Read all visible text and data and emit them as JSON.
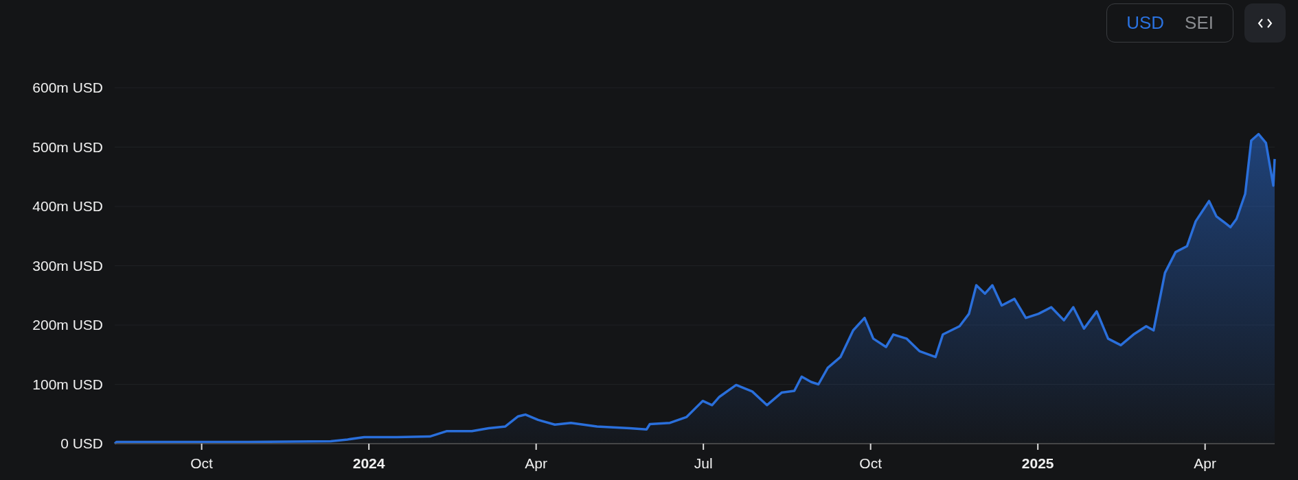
{
  "currency_toggle": {
    "options": [
      {
        "label": "USD",
        "selected": true
      },
      {
        "label": "SEI",
        "selected": false
      }
    ]
  },
  "chart": {
    "chart_data": {
      "type": "area",
      "grid": true,
      "xlim": [
        2023.62,
        2025.354
      ],
      "ylim": [
        0,
        600
      ],
      "yticks": [
        {
          "value": 0,
          "label": "0 USD"
        },
        {
          "value": 100,
          "label": "100m USD"
        },
        {
          "value": 200,
          "label": "200m USD"
        },
        {
          "value": 300,
          "label": "300m USD"
        },
        {
          "value": 400,
          "label": "400m USD"
        },
        {
          "value": 500,
          "label": "500m USD"
        },
        {
          "value": 600,
          "label": "600m USD"
        }
      ],
      "xticks": [
        {
          "value": 2023.75,
          "label": "Oct"
        },
        2024,
        {
          "value": 2024.25,
          "label": "Apr"
        },
        {
          "value": 2024.5,
          "label": "Jul"
        },
        {
          "value": 2024.75,
          "label": "Oct"
        },
        2025,
        {
          "value": 2025.25,
          "label": "Apr"
        }
      ],
      "x": [
        2023.62,
        2023.623,
        2023.697,
        2023.82,
        2023.943,
        2023.968,
        2023.993,
        2024.042,
        2024.091,
        2024.116,
        2024.154,
        2024.179,
        2024.204,
        2024.223,
        2024.234,
        2024.253,
        2024.278,
        2024.302,
        2024.341,
        2024.39,
        2024.415,
        2024.42,
        2024.45,
        2024.475,
        2024.499,
        2024.513,
        2024.524,
        2024.549,
        2024.573,
        2024.595,
        2024.617,
        2024.636,
        2024.647,
        2024.661,
        2024.672,
        2024.686,
        2024.705,
        2024.724,
        2024.741,
        2024.754,
        2024.773,
        2024.784,
        2024.804,
        2024.823,
        2024.847,
        2024.858,
        2024.883,
        2024.897,
        2024.908,
        2024.921,
        2024.932,
        2024.946,
        2024.965,
        2024.982,
        2025.001,
        2025.02,
        2025.039,
        2025.053,
        2025.069,
        2025.088,
        2025.105,
        2025.124,
        2025.143,
        2025.162,
        2025.173,
        2025.19,
        2025.206,
        2025.223,
        2025.236,
        2025.256,
        2025.267,
        2025.28,
        2025.288,
        2025.297,
        2025.31,
        2025.319,
        2025.33,
        2025.341,
        2025.352,
        2025.354
      ],
      "series": [
        {
          "color": "#2a6fdb",
          "values": [
            0,
            3,
            3,
            3,
            4,
            7,
            11,
            11,
            12,
            21,
            21,
            26,
            29,
            46,
            49,
            40,
            32,
            35,
            29,
            26,
            24,
            33,
            35,
            45,
            72,
            65,
            79,
            99,
            88,
            65,
            86,
            89,
            113,
            104,
            100,
            128,
            146,
            191,
            212,
            177,
            163,
            184,
            177,
            156,
            146,
            184,
            198,
            219,
            267,
            253,
            267,
            233,
            244,
            212,
            219,
            230,
            208,
            230,
            194,
            223,
            177,
            166,
            184,
            198,
            191,
            288,
            323,
            333,
            375,
            409,
            383,
            372,
            365,
            379,
            421,
            511,
            522,
            507,
            435,
            480
          ]
        }
      ]
    }
  }
}
